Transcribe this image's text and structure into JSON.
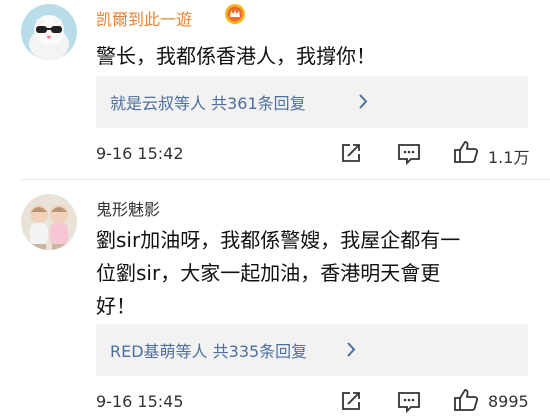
{
  "comments": [
    {
      "username": "凯爾到此一遊",
      "text": "警长，我都係香港人，我撐你！",
      "reply_summary": "就是云叔等人 共361条回复",
      "time": "9-16 15:42",
      "likes": "1.1万",
      "avatar_icon": "cat-with-sunglasses-avatar",
      "badge_icon": "vip-crown-icon"
    },
    {
      "username": "鬼形魅影",
      "text_lines": [
        "劉sir加油呀，我都係警嫂，我屋企都有一",
        "位劉sir，大家一起加油，香港明天會更",
        "好！"
      ],
      "reply_summary": "RED基萌等人 共335条回复",
      "time": "9-16 15:45",
      "likes": "8995",
      "avatar_icon": "two-babies-avatar"
    }
  ],
  "colors": {
    "vip_name": "#e58432",
    "link": "#4d6fa0",
    "reply_bg": "#f2f2f2",
    "icon": "#333333"
  }
}
